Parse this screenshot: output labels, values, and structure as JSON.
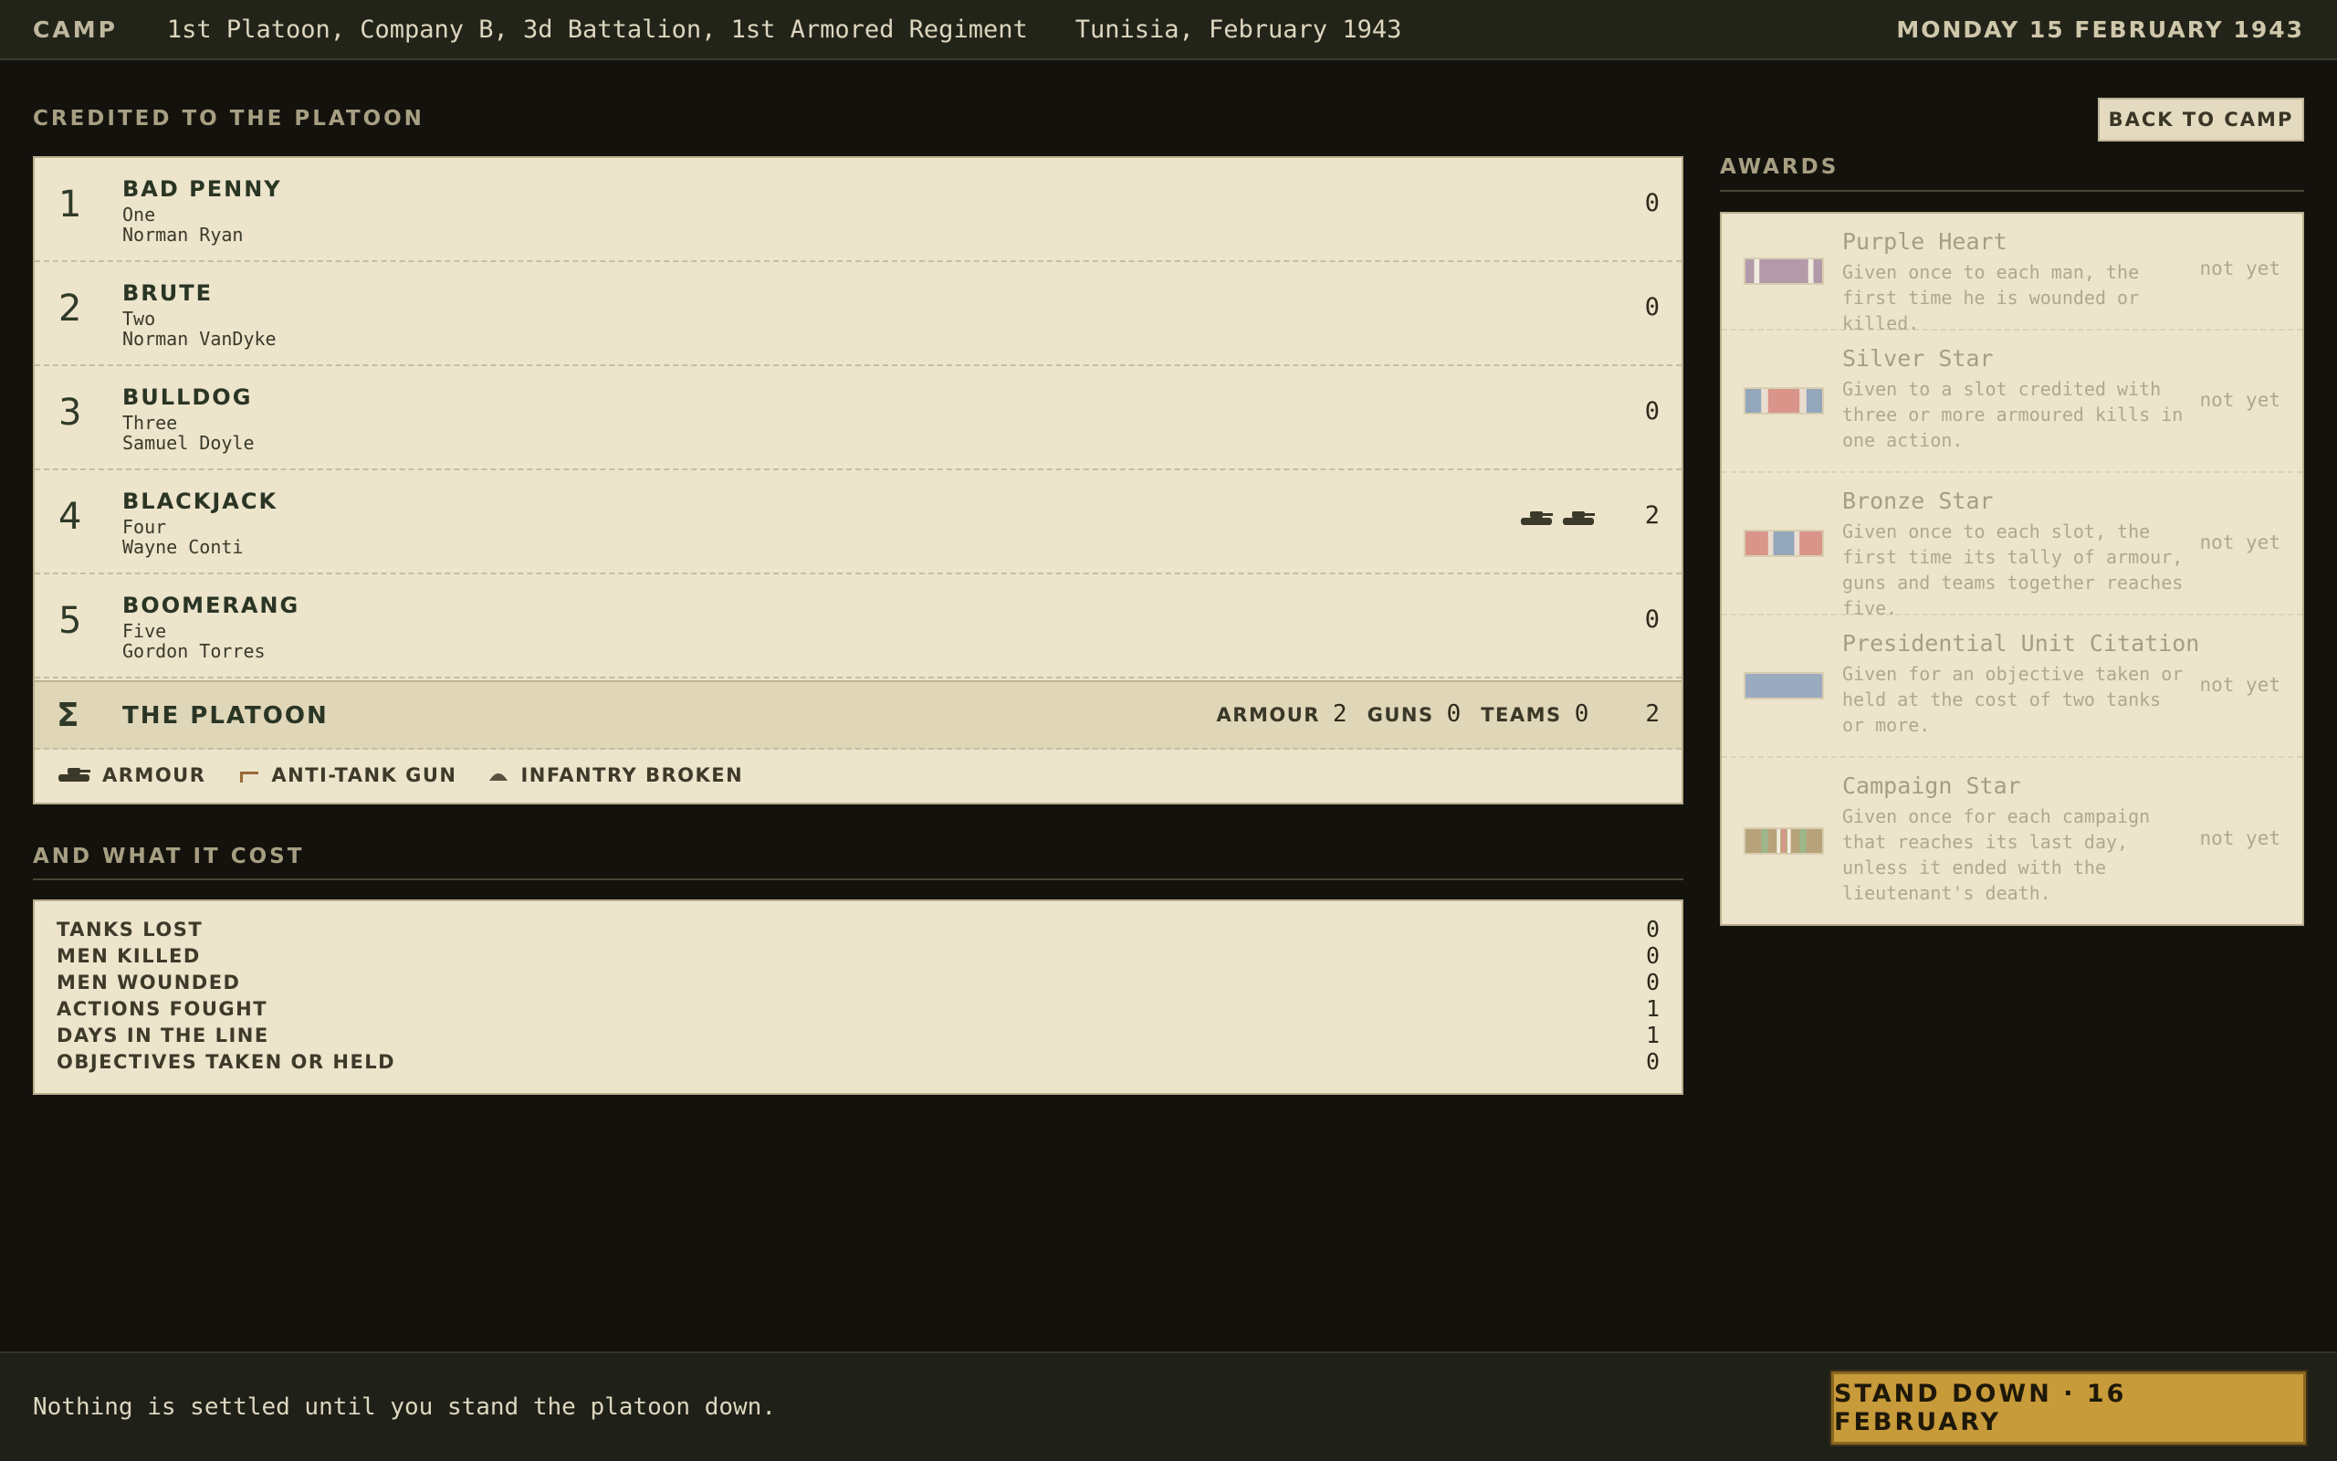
{
  "header": {
    "camp_label": "CAMP",
    "unit": "1st Platoon, Company B, 3d Battalion, 1st Armored Regiment",
    "place": "Tunisia, February 1943",
    "date": "MONDAY 15 FEBRUARY 1943"
  },
  "credited": {
    "title": "CREDITED TO THE PLATOON",
    "back_label": "BACK TO CAMP",
    "rows": [
      {
        "num": "1",
        "name": "BAD PENNY",
        "slot": "One",
        "commander": "Norman Ryan",
        "score": "0",
        "armour_kills": 0
      },
      {
        "num": "2",
        "name": "BRUTE",
        "slot": "Two",
        "commander": "Norman VanDyke",
        "score": "0",
        "armour_kills": 0
      },
      {
        "num": "3",
        "name": "BULLDOG",
        "slot": "Three",
        "commander": "Samuel Doyle",
        "score": "0",
        "armour_kills": 0
      },
      {
        "num": "4",
        "name": "BLACKJACK",
        "slot": "Four",
        "commander": "Wayne Conti",
        "score": "2",
        "armour_kills": 2
      },
      {
        "num": "5",
        "name": "BOOMERANG",
        "slot": "Five",
        "commander": "Gordon Torres",
        "score": "0",
        "armour_kills": 0
      }
    ],
    "total": {
      "symbol": "Σ",
      "name": "THE PLATOON",
      "armour_label": "ARMOUR",
      "armour": "2",
      "guns_label": "GUNS",
      "guns": "0",
      "teams_label": "TEAMS",
      "teams": "0",
      "total": "2"
    },
    "legend": {
      "armour": "ARMOUR",
      "gun": "ANTI-TANK GUN",
      "infantry": "INFANTRY BROKEN"
    }
  },
  "cost": {
    "title": "AND WHAT IT COST",
    "lines": [
      {
        "label": "TANKS LOST",
        "value": "0"
      },
      {
        "label": "MEN KILLED",
        "value": "0"
      },
      {
        "label": "MEN WOUNDED",
        "value": "0"
      },
      {
        "label": "ACTIONS FOUGHT",
        "value": "1"
      },
      {
        "label": "DAYS IN THE LINE",
        "value": "1"
      },
      {
        "label": "OBJECTIVES TAKEN OR HELD",
        "value": "0"
      }
    ]
  },
  "awards": {
    "title": "AWARDS",
    "items": [
      {
        "name": "Purple Heart",
        "desc": "Given once to each man, the first time he is wounded or killed.",
        "status": "not yet"
      },
      {
        "name": "Silver Star",
        "desc": "Given to a slot credited with three or more armoured kills in one action.",
        "status": "not yet"
      },
      {
        "name": "Bronze Star",
        "desc": "Given once to each slot, the first time its tally of armour, guns and teams together reaches five.",
        "status": "not yet"
      },
      {
        "name": "Presidential Unit Citation",
        "desc": "Given for an objective taken or held at the cost of two tanks or more.",
        "status": "not yet"
      },
      {
        "name": "Campaign Star",
        "desc": "Given once for each campaign that reaches its last day, unless it ended with the lieutenant's death.",
        "status": "not yet"
      }
    ]
  },
  "footer": {
    "note": "Nothing is settled until you stand the platoon down.",
    "stand_down_label": "STAND DOWN · 16 FEBRUARY"
  },
  "colors": {
    "accent_button": "#c79a3a",
    "panel": "#ede4cc",
    "background": "#14120d"
  }
}
